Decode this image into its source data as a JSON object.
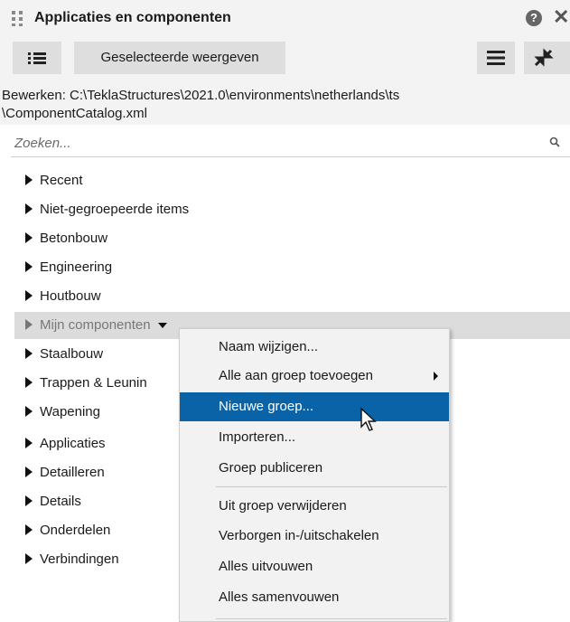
{
  "window": {
    "title": "Applicaties en componenten",
    "help_icon": "?",
    "close_icon": "✕"
  },
  "toolbar": {
    "show_selected_label": "Geselecteerde weergeven"
  },
  "path": {
    "line1": "Bewerken:  C:\\TeklaStructures\\2021.0\\environments\\netherlands\\ts",
    "line2": "\\ComponentCatalog.xml"
  },
  "search": {
    "placeholder": "Zoeken..."
  },
  "tree": [
    "Recent",
    "Niet-gegroepeerde items",
    "Betonbouw",
    "Engineering",
    "Houtbouw",
    "Mijn componenten",
    "Staalbouw",
    "Trappen & Leunin",
    "Wapening",
    "Applicaties",
    "Detailleren",
    "Details",
    "Onderdelen",
    "Verbindingen"
  ],
  "context_menu": [
    "Naam wijzigen...",
    "Alle aan groep toevoegen",
    "Nieuwe groep...",
    "Importeren...",
    "Groep publiceren",
    "Uit groep verwijderen",
    "Verborgen in-/uitschakelen",
    "Alles uitvouwen",
    "Alles samenvouwen"
  ],
  "colors": {
    "highlight": "#0a63a6",
    "panel": "#f3f3f3",
    "button": "#dedede"
  }
}
